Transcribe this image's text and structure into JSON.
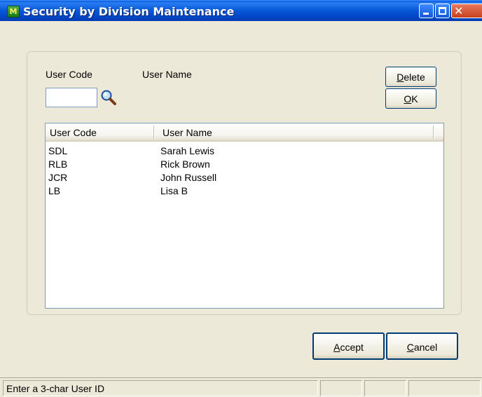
{
  "window": {
    "title": "Security by Division Maintenance",
    "app_icon_glyph": "M",
    "close_glyph": "✕"
  },
  "form": {
    "user_code_label": "User Code",
    "user_name_label": "User Name",
    "user_code_value": "",
    "delete_label": "Delete",
    "ok_label": "OK",
    "lookup_icon": "magnifier-icon"
  },
  "list": {
    "columns": [
      "User Code",
      "User Name"
    ],
    "rows": [
      {
        "code": "SDL",
        "name": "Sarah Lewis"
      },
      {
        "code": "RLB",
        "name": "Rick Brown"
      },
      {
        "code": "JCR",
        "name": "John Russell"
      },
      {
        "code": "LB",
        "name": "Lisa B"
      }
    ]
  },
  "footer": {
    "accept_label": "Accept",
    "cancel_label": "Cancel"
  },
  "status": {
    "message": "Enter a 3-char User ID"
  },
  "colors": {
    "titlebar": "#0a5ad8",
    "face": "#ece9d8",
    "border": "#7f9db9"
  }
}
